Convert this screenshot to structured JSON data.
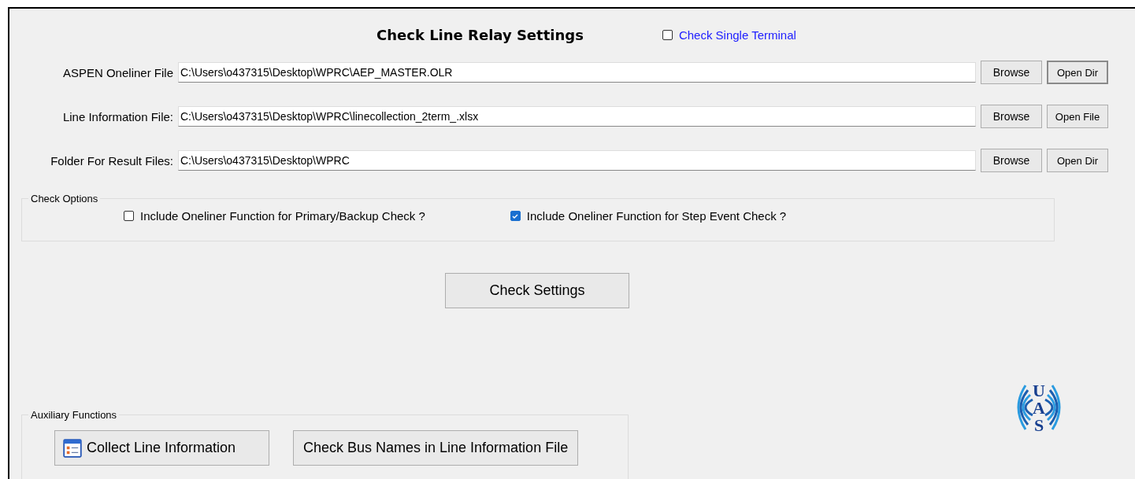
{
  "title": "Check Line Relay Settings",
  "single_terminal": {
    "label": "Check Single Terminal",
    "checked": false
  },
  "file_rows": [
    {
      "label": "ASPEN Oneliner File",
      "value": "C:\\Users\\o437315\\Desktop\\WPRC\\AEP_MASTER.OLR",
      "browse": "Browse",
      "open": "Open Dir",
      "open_focused": true
    },
    {
      "label": "Line Information File:",
      "value": "C:\\Users\\o437315\\Desktop\\WPRC\\linecollection_2term_.xlsx",
      "browse": "Browse",
      "open": "Open File",
      "open_focused": false
    },
    {
      "label": "Folder For Result Files:",
      "value": "C:\\Users\\o437315\\Desktop\\WPRC",
      "browse": "Browse",
      "open": "Open Dir",
      "open_focused": false
    }
  ],
  "check_options": {
    "title": "Check Options",
    "options": [
      {
        "label": "Include Oneliner Function for Primary/Backup Check ?",
        "checked": false
      },
      {
        "label": "Include Oneliner Function for Step Event Check ?",
        "checked": true
      }
    ]
  },
  "check_button": "Check Settings",
  "auxiliary": {
    "title": "Auxiliary Functions",
    "buttons": [
      {
        "label": "Collect Line Information",
        "kind": "icon"
      },
      {
        "label": "Check Bus Names in Line Information File",
        "kind": "plain"
      }
    ]
  },
  "logo": {
    "letters": [
      "U",
      "A",
      "S"
    ]
  }
}
